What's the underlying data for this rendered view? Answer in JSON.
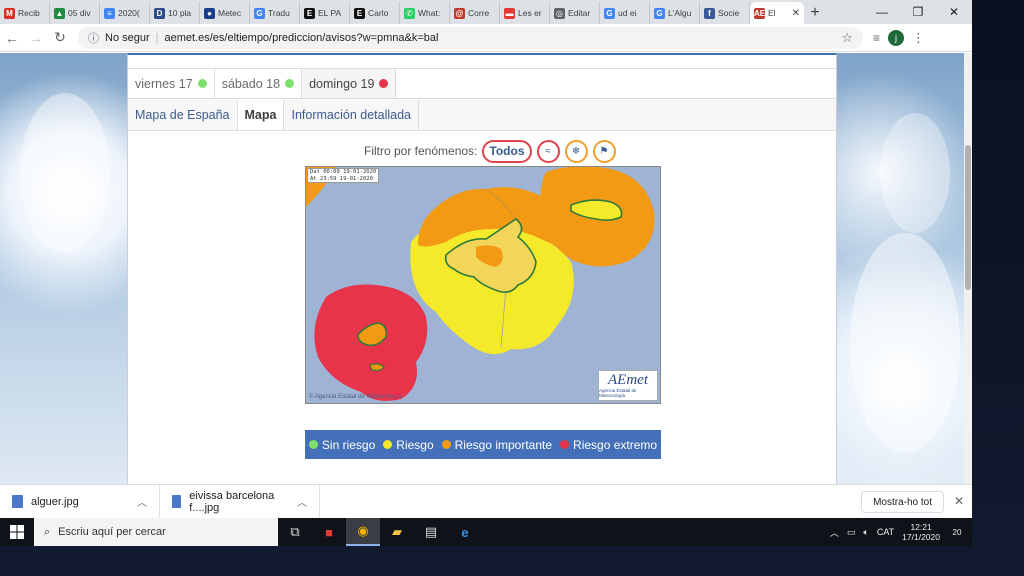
{
  "browser": {
    "tabs": [
      {
        "label": "Recib",
        "favicon": "gmail-icon",
        "color": "#d93025",
        "glyph": "M"
      },
      {
        "label": "05 div",
        "favicon": "drive-icon",
        "color": "#1e8e3e",
        "glyph": "▲"
      },
      {
        "label": "2020(",
        "favicon": "docs-icon",
        "color": "#4285f4",
        "glyph": "≡"
      },
      {
        "label": "10 pla",
        "favicon": "dictionary-icon",
        "color": "#2b4a8b",
        "glyph": "D"
      },
      {
        "label": "Metec",
        "favicon": "weather-icon",
        "color": "#1a3f8a",
        "glyph": "●"
      },
      {
        "label": "Tradu",
        "favicon": "translate-icon",
        "color": "#4285f4",
        "glyph": "G"
      },
      {
        "label": "EL PA",
        "favicon": "elpais-icon",
        "color": "#111111",
        "glyph": "E"
      },
      {
        "label": "Carlo",
        "favicon": "elpais-icon",
        "color": "#111111",
        "glyph": "E"
      },
      {
        "label": "What:",
        "favicon": "whatsapp-icon",
        "color": "#25d366",
        "glyph": "✆"
      },
      {
        "label": "Corre",
        "favicon": "mail-icon",
        "color": "#c0392b",
        "glyph": "@"
      },
      {
        "label": "Les er",
        "favicon": "flag-icon",
        "color": "#e53935",
        "glyph": "▬"
      },
      {
        "label": "Editar",
        "favicon": "globe-icon",
        "color": "#5f6368",
        "glyph": "◎"
      },
      {
        "label": "ud ei",
        "favicon": "google-icon",
        "color": "#4285f4",
        "glyph": "G"
      },
      {
        "label": "L'Algu",
        "favicon": "google-icon",
        "color": "#4285f4",
        "glyph": "G"
      },
      {
        "label": "Socie",
        "favicon": "facebook-icon",
        "color": "#3b5998",
        "glyph": "f"
      },
      {
        "label": "El",
        "favicon": "aemet-icon",
        "color": "#c0392b",
        "glyph": "AE",
        "active": true
      }
    ],
    "not_secure_label": "No segur",
    "url": "aemet.es/es/eltiempo/prediccion/avisos?w=pmna&k=bal",
    "profile_initial": "j"
  },
  "page": {
    "day_tabs": [
      {
        "label": "viernes 17",
        "dot": "#7ee06e"
      },
      {
        "label": "sábado 18",
        "dot": "#7ee06e"
      },
      {
        "label": "domingo 19",
        "dot": "#e8344a",
        "selected": true
      }
    ],
    "view_tabs": [
      {
        "label": "Mapa de España"
      },
      {
        "label": "Mapa",
        "selected": true
      },
      {
        "label": "Información detallada"
      }
    ],
    "filter_label": "Filtro por fenómenos:",
    "filter_all": "Todos",
    "filter_icons": [
      {
        "name": "coastal-icon",
        "glyph": "≈",
        "border": "#e0434b"
      },
      {
        "name": "snow-icon",
        "glyph": "❄",
        "border": "#f0a02a"
      },
      {
        "name": "wind-icon",
        "glyph": "⚑",
        "border": "#f0a02a"
      }
    ],
    "map": {
      "date_line1": "Dat 00:00 19-01-2020",
      "date_line2": "At  23:59 19-01-2020",
      "logo_text": "AEmet",
      "logo_sub": "Agencia Estatal de Meteorología",
      "copyright": "© Agencia Estatal de Meteorología"
    },
    "legend": [
      {
        "label": "Sin riesgo",
        "color": "#7ee06e"
      },
      {
        "label": "Riesgo",
        "color": "#f4ea2a"
      },
      {
        "label": "Riesgo importante",
        "color": "#f29a14"
      },
      {
        "label": "Riesgo extremo",
        "color": "#e8344a"
      }
    ]
  },
  "downloads": {
    "files": [
      "alguer.jpg",
      "eivissa barcelona f....jpg"
    ],
    "show_all": "Mostra-ho tot"
  },
  "taskbar": {
    "search_placeholder": "Escriu aquí per cercar",
    "language": "CAT",
    "time": "12:21",
    "date": "17/1/2020",
    "notifications": "20"
  }
}
